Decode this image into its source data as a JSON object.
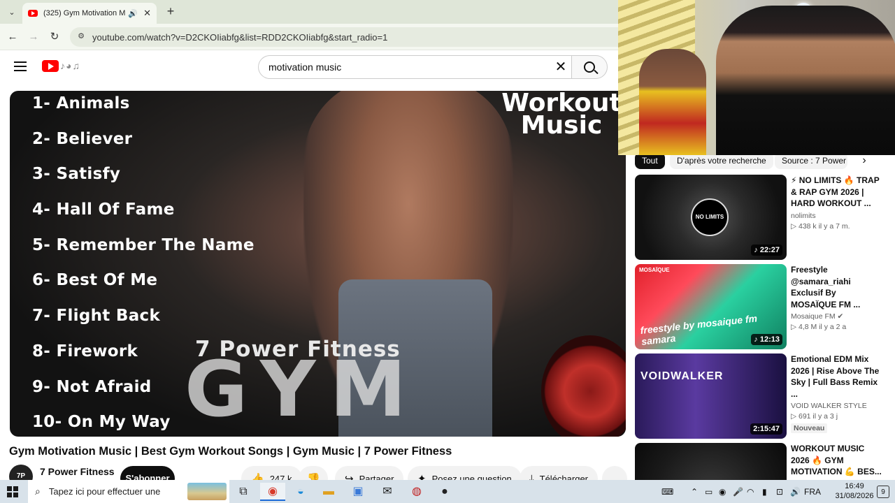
{
  "browser": {
    "tab_title": "(325) Gym Motivation Musi",
    "new_tab_label": "+",
    "url": "youtube.com/watch?v=D2CKOIiabfg&list=RDD2CKOIiabfg&start_radio=1"
  },
  "youtube": {
    "search_query": "motivation music",
    "video": {
      "songs": [
        "1- Animals",
        "2- Believer",
        "3- Satisfy",
        "4- Hall Of Fame",
        "5- Remember The Name",
        "6- Best Of Me",
        "7- Flight Back",
        "8- Firework",
        "9- Not Afraid",
        "10- On My Way"
      ],
      "overlay_title_line1": "Workout",
      "overlay_title_line2": "Music",
      "overlay_brand": "7 Power Fitness",
      "overlay_big": "GYM",
      "title": "Gym Motivation Music | Best Gym Workout Songs | Gym Music | 7 Power Fitness",
      "channel": "7 Power Fitness",
      "avatar_text": "7P",
      "subscribe_label": "S'abonner",
      "likes": "247 k",
      "share_label": "Partager",
      "ask_label": "Posez une question",
      "download_label": "Télécharger",
      "more_label": "..."
    },
    "chips": [
      "Tout",
      "D'après votre recherche",
      "Source : 7 Power"
    ],
    "recommendations": [
      {
        "title": "⚡ NO LIMITS 🔥 TRAP & RAP GYM 2026 | HARD WORKOUT ...",
        "channel": "nolimits",
        "meta": "▷ 438 k   il y a 7 m.",
        "duration": "♪ 22:27",
        "thumb_text": "NO LIMITS"
      },
      {
        "title": "Freestyle @samara_riahi Exclusif By MOSAÏQUE FM ...",
        "channel": "Mosaique FM ✔",
        "meta": "▷ 4,8 M   il y a 2 a",
        "duration": "♪ 12:13",
        "thumb_text_top": "MOSAÏQUE",
        "thumb_text": "freestyle by mosaique fm samara"
      },
      {
        "title": "Emotional EDM Mix 2026 | Rise Above The Sky | Full Bass Remix ...",
        "channel": "VOID WALKER STYLE",
        "meta": "▷ 691   il y a 3 j",
        "duration": "2:15:47",
        "badge": "Nouveau",
        "thumb_text": "VOIDWALKER"
      },
      {
        "title": "WORKOUT MUSIC 2026 🔥 GYM MOTIVATION 💪 BES...",
        "channel": "",
        "meta": "",
        "duration": ""
      }
    ]
  },
  "taskbar": {
    "search_placeholder": "Tapez ici pour effectuer une",
    "language": "FRA",
    "time": "16:49",
    "date": "31/08/2026",
    "notifications": "9"
  }
}
